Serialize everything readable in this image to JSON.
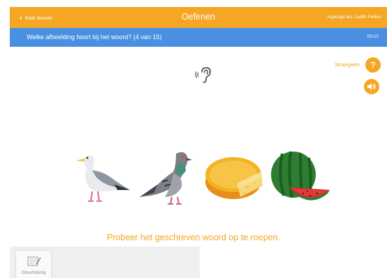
{
  "header": {
    "back_label": "Naar dossier",
    "title": "Oefenen",
    "user_label": "Ingelogd als: Judith Felken"
  },
  "question": {
    "text": "Welke afbeelding hoort bij het woord?  (4 van 15)",
    "timer": "00:12"
  },
  "strategy": {
    "label": "Strategieën",
    "help_icon": "question-icon",
    "sound_icon": "speaker-icon"
  },
  "audio": {
    "icon": "ear-icon"
  },
  "options": [
    {
      "icon": "seagull-image"
    },
    {
      "icon": "pigeon-image"
    },
    {
      "icon": "cheese-image"
    },
    {
      "icon": "watermelon-image"
    }
  ],
  "prompt": "Probeer het geschreven woord op te roepen.",
  "toolbar": {
    "items": [
      {
        "label": "Omschrijving",
        "icon": "notepad-icon"
      }
    ]
  },
  "colors": {
    "accent": "#f5a623",
    "question_bar": "#4a90e2",
    "tray": "#efefef"
  }
}
